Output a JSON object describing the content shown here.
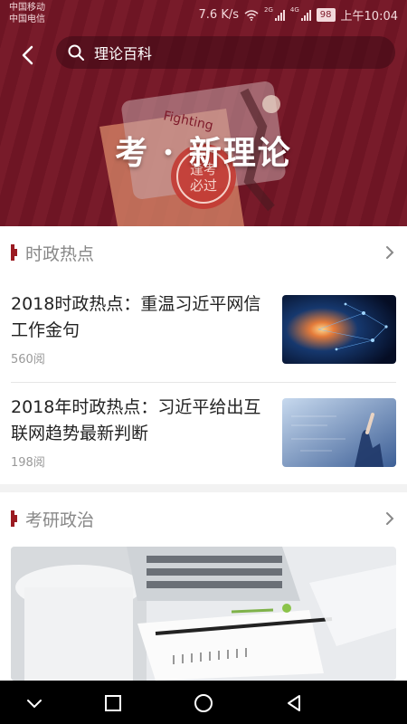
{
  "status_bar": {
    "carrier1": "中国移动",
    "carrier2": "中国电信",
    "speed": "7.6 K/s",
    "net1": "2G",
    "net2": "4G",
    "battery": "98",
    "time": "上午10:04"
  },
  "search": {
    "value": "理论百科"
  },
  "hero": {
    "title": "考 · 新理论",
    "stamp_text1": "逢考",
    "stamp_text2": "必过",
    "note_text": "Fighting"
  },
  "sections": [
    {
      "title": "时政热点",
      "items": [
        {
          "title": "2018时政热点：重温习近平网信工作金句",
          "meta": "560阅"
        },
        {
          "title": "2018年时政热点：习近平给出互联网趋势最新判断",
          "meta": "198阅"
        }
      ]
    },
    {
      "title": "考研政治"
    }
  ],
  "colors": {
    "brand": "#9b1b22",
    "hero_bg": "#7e1a2a"
  },
  "icons": [
    "back-arrow-icon",
    "search-icon",
    "chevron-right-icon",
    "nav-back-icon",
    "nav-home-icon",
    "nav-recents-icon",
    "nav-down-icon"
  ]
}
